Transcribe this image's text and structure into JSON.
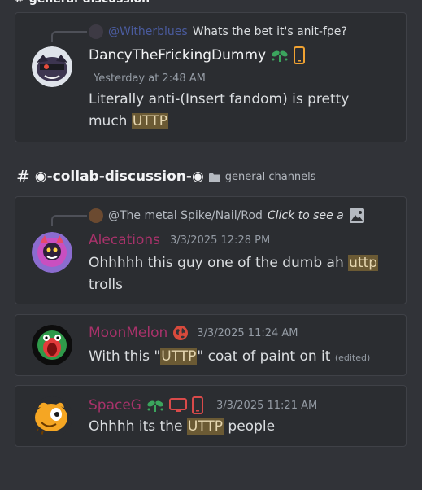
{
  "top_header": {
    "label": "general-discussion"
  },
  "messages": [
    {
      "reply": {
        "author": "@Witherblues",
        "text": "Whats the bet it's anit-fpe?"
      },
      "author": "DancyTheFrickingDummy",
      "timestamp": "Yesterday at 2:48 AM",
      "text_lines": [
        {
          "before": "Literally anti-(Insert fandom) is pretty",
          "hl": "",
          "after": ""
        },
        {
          "before": "much ",
          "hl": "UTTP",
          "after": ""
        }
      ]
    }
  ],
  "channel": {
    "name": "◉-collab-discussion-◉",
    "category": "general channels"
  },
  "messages2": [
    {
      "reply": {
        "author": "@The metal Spike/Nail/Rod",
        "text": "Click to see a"
      },
      "author": "Alecations",
      "timestamp": "3/3/2025 12:28 PM",
      "line1_before": "Ohhhhh this guy one of the dumb ah ",
      "line1_hl": "uttp",
      "line2": "trolls",
      "author_color": "#a8326a"
    },
    {
      "author": "MoonMelon",
      "timestamp": "3/3/2025 11:24 AM",
      "before": "With this \"",
      "hl": "UTTP",
      "after": "\" coat of paint on it ",
      "edited": "(edited)",
      "author_color": "#a8326a"
    },
    {
      "author": "SpaceG",
      "timestamp": "3/3/2025 11:21 AM",
      "before": "Ohhhh its the ",
      "hl": "UTTP",
      "after": " people",
      "author_color": "#a8326a"
    }
  ],
  "colors": {
    "background": "#313338",
    "card": "#2b2d31",
    "highlight": "#6b5a34",
    "mention": "#4752a8"
  }
}
